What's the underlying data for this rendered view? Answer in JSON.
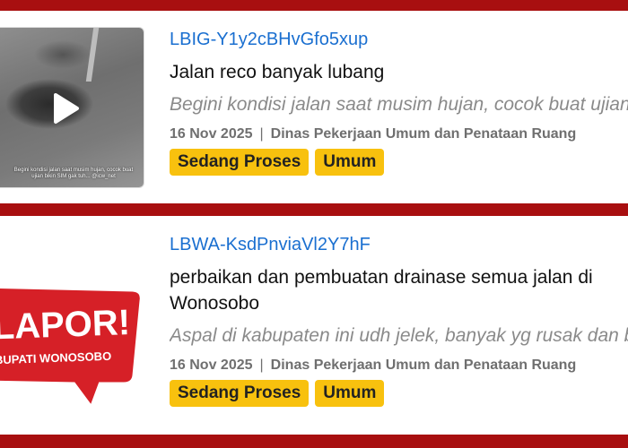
{
  "reports": [
    {
      "code": "LBIG-Y1y2cBHvGfo5xup",
      "title": "Jalan reco banyak lubang",
      "description": "Begini kondisi jalan saat musim hujan, cocok buat ujian bikin SIM gak tuh",
      "date": "16 Nov 2025",
      "separator": "|",
      "agency": "Dinas Pekerjaan Umum dan Penataan Ruang",
      "status": "Sedang Proses",
      "category": "Umum",
      "thumbnail_caption": "Begini kondisi jalan saat musim hujan, cocok buat ujian bikin SIM gak tuh... @icw_net",
      "has_video": true
    },
    {
      "code": "LBWA-KsdPnviaVl2Y7hF",
      "title": "perbaikan dan pembuatan drainase semua jalan di Wonosobo",
      "description": "Aspal di kabupaten ini udh jelek, banyak yg rusak dan berlubang",
      "date": "16 Nov 2025",
      "separator": "|",
      "agency": "Dinas Pekerjaan Umum dan Penataan Ruang",
      "status": "Sedang Proses",
      "category": "Umum",
      "logo_text_main": "LAPOR!",
      "logo_text_sub": "BUPATI WONOSOBO"
    }
  ],
  "colors": {
    "background": "#a80f10",
    "code_link": "#1a6fd0",
    "badge": "#f8c10e",
    "logo_red": "#d62027"
  }
}
